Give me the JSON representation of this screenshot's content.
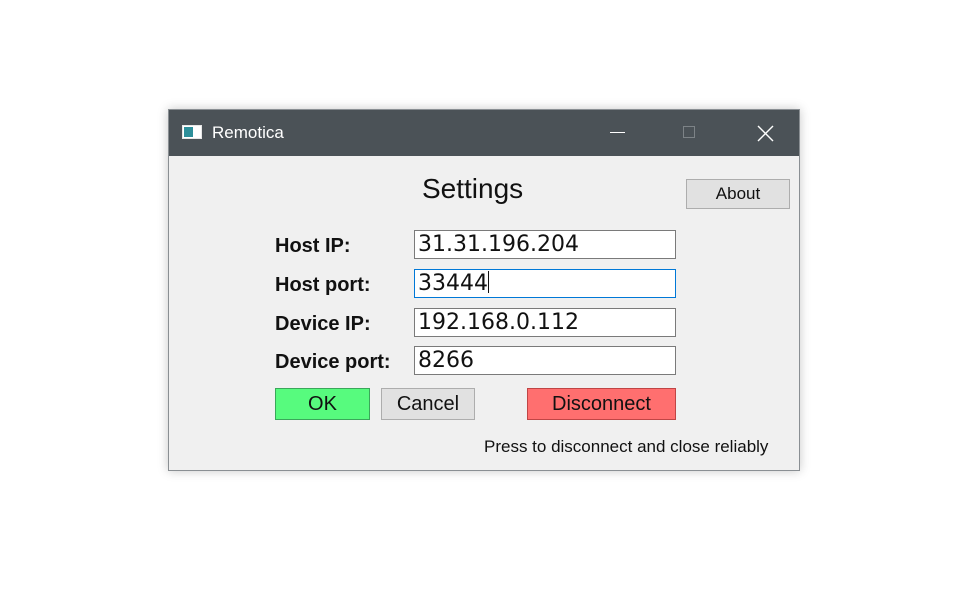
{
  "window": {
    "title": "Remotica",
    "icon": "app-window-icon",
    "controls": [
      "minimize-icon",
      "maximize-icon",
      "close-icon"
    ]
  },
  "settings": {
    "heading": "Settings",
    "about_label": "About",
    "fields": [
      {
        "label": "Host IP:",
        "value": "31.31.196.204"
      },
      {
        "label": "Host port:",
        "value": "33444"
      },
      {
        "label": "Device IP:",
        "value": "192.168.0.112"
      },
      {
        "label": "Device port:",
        "value": "8266"
      }
    ],
    "focused_field": "Host port:"
  },
  "actions": {
    "ok_label": "OK",
    "cancel_label": "Cancel",
    "disconnect_label": "Disconnect",
    "disconnect_hint": "Press to disconnect and close reliably"
  },
  "colors": {
    "titlebar": "#4b5257",
    "ok": "#57fb7e",
    "disconnect": "#ff6f6f",
    "focus_border": "#0078d7"
  }
}
